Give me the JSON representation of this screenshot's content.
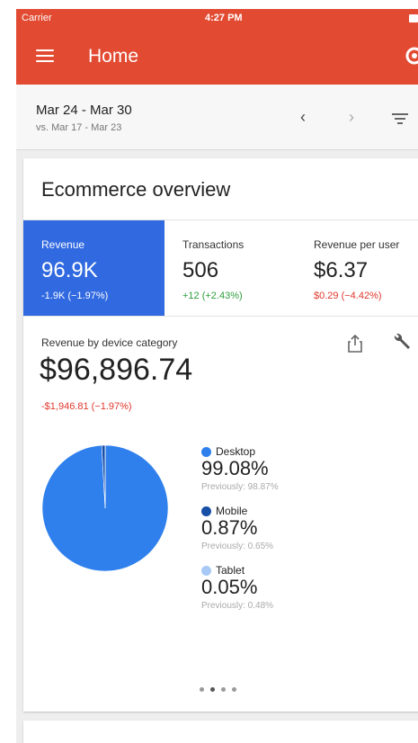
{
  "status_bar": {
    "carrier": "Carrier",
    "time": "4:27 PM"
  },
  "app_bar": {
    "title": "Home"
  },
  "date_range": {
    "main": "Mar 24 - Mar 30",
    "compare": "vs. Mar 17 - Mar 23"
  },
  "card": {
    "title": "Ecommerce overview"
  },
  "metrics": [
    {
      "label": "Revenue",
      "value": "96.9K",
      "change": "-1.9K (−1.97%)",
      "direction": "negative",
      "selected": true
    },
    {
      "label": "Transactions",
      "value": "506",
      "change": "+12 (+2.43%)",
      "direction": "positive",
      "selected": false
    },
    {
      "label": "Revenue per user",
      "value": "$6.37",
      "change": "$0.29 (−4.42%)",
      "direction": "negative",
      "selected": false
    }
  ],
  "device_chart": {
    "label": "Revenue by device category",
    "total": "$96,896.74",
    "change": "-$1,946.81 (−1.97%)",
    "page_indicator": {
      "count": 4,
      "active": 1
    }
  },
  "chart_data": {
    "type": "pie",
    "title": "Revenue by device category",
    "slices": [
      {
        "name": "Desktop",
        "value": 99.08,
        "value_label": "99.08%",
        "previous": "Previously: 98.87%",
        "color": "#2f80ed"
      },
      {
        "name": "Mobile",
        "value": 0.87,
        "value_label": "0.87%",
        "previous": "Previously: 0.65%",
        "color": "#174ea6"
      },
      {
        "name": "Tablet",
        "value": 0.05,
        "value_label": "0.05%",
        "previous": "Previously: 0.48%",
        "color": "#a8c9f5"
      }
    ]
  },
  "colors": {
    "app_bar": "#e24a32",
    "selected_metric": "#3069e0",
    "positive": "#2e9e3f",
    "negative": "#e0362c"
  },
  "icons": {
    "menu": "hamburger-menu-icon",
    "sync": "sync-icon",
    "prev": "chevron-left-icon",
    "next": "chevron-right-icon",
    "filter": "filter-icon",
    "share": "share-icon",
    "customize": "wrench-icon"
  }
}
